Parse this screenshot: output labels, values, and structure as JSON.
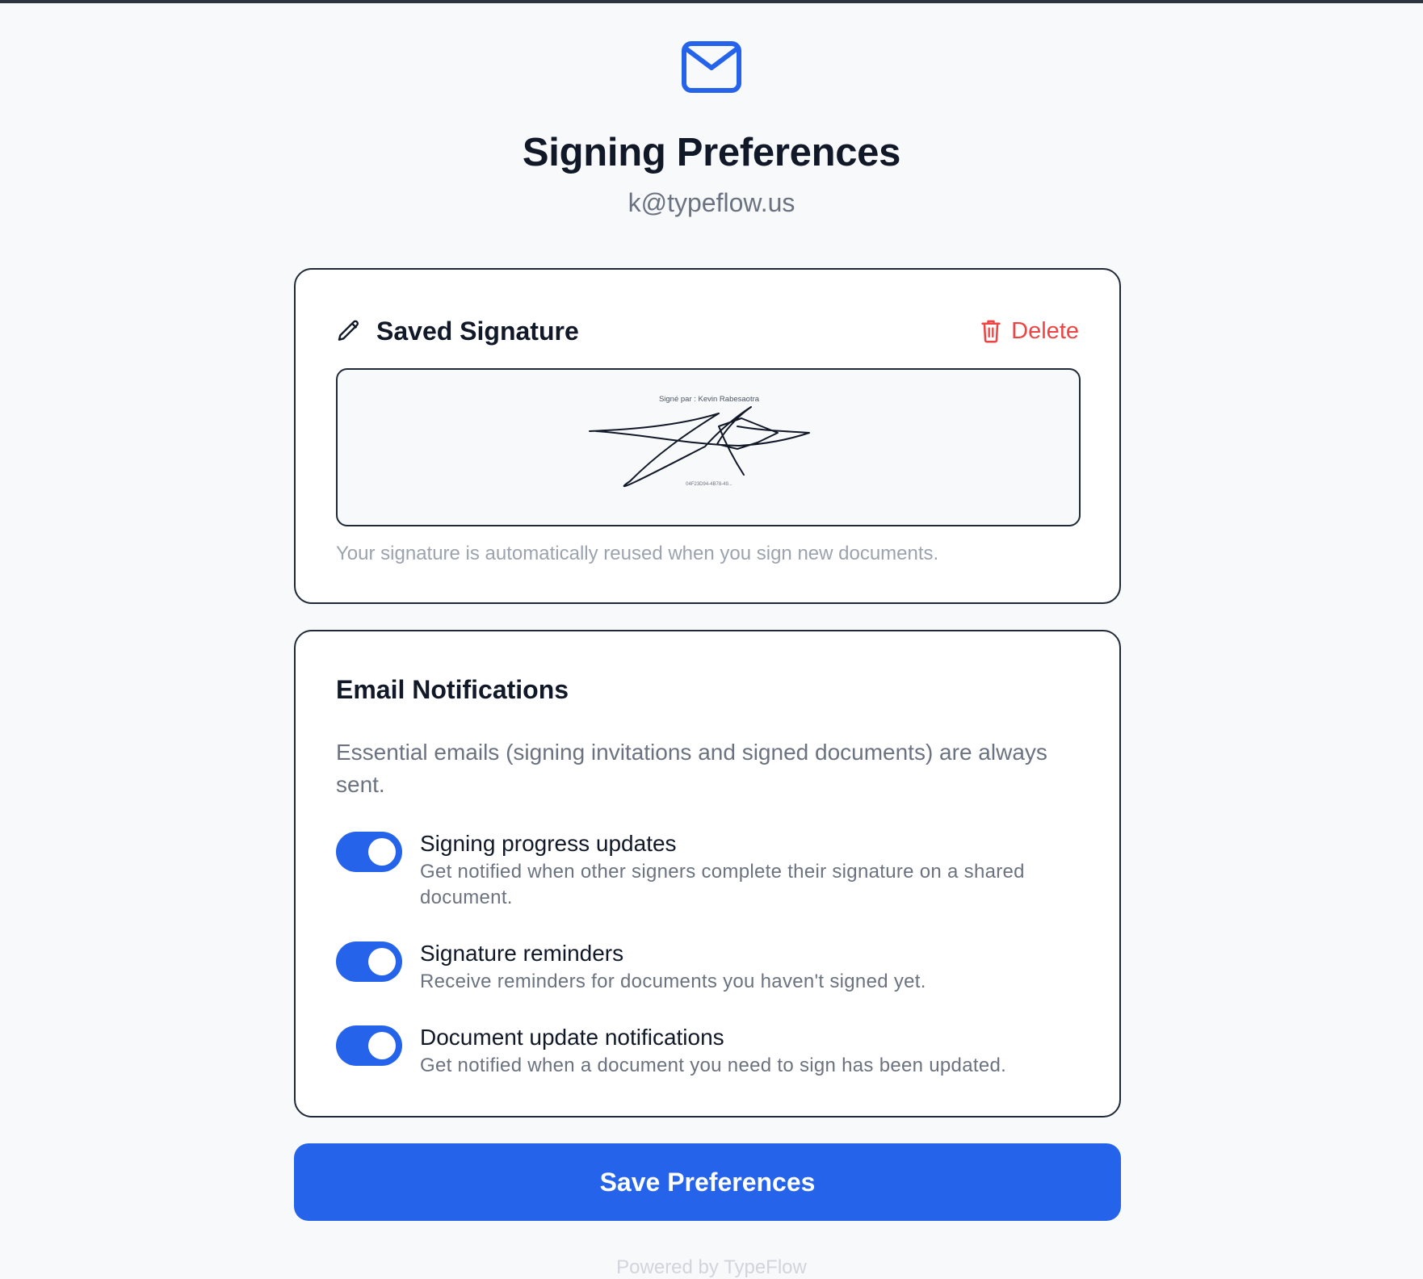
{
  "header": {
    "icon": "mail-icon",
    "title": "Signing Preferences",
    "email": "k@typeflow.us"
  },
  "signature": {
    "icon": "pencil-icon",
    "title": "Saved Signature",
    "delete_label": "Delete",
    "delete_icon": "trash-icon",
    "signed_by": "Signé par : Kevin Rabesaotra",
    "signature_id": "04F23D94-4B78-49...",
    "note": "Your signature is automatically reused when you sign new documents."
  },
  "notifications": {
    "title": "Email Notifications",
    "description": "Essential emails (signing invitations and signed documents) are always sent.",
    "items": [
      {
        "label": "Signing progress updates",
        "sub": "Get notified when other signers complete their signature on a shared document.",
        "enabled": true
      },
      {
        "label": "Signature reminders",
        "sub": "Receive reminders for documents you haven't signed yet.",
        "enabled": true
      },
      {
        "label": "Document update notifications",
        "sub": "Get notified when a document you need to sign has been updated.",
        "enabled": true
      }
    ]
  },
  "save_label": "Save Preferences",
  "footer": "Powered by TypeFlow",
  "colors": {
    "accent": "#2563eb",
    "danger": "#ef4444",
    "muted": "#6b7280"
  }
}
